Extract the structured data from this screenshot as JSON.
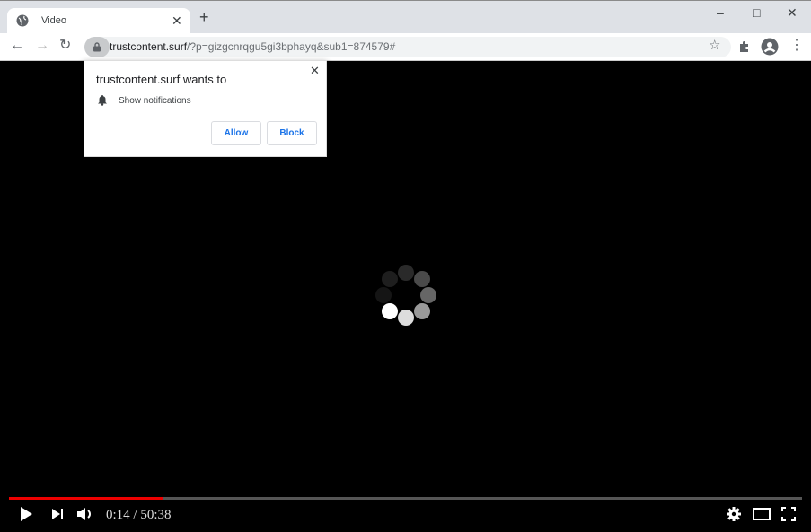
{
  "browser": {
    "tab": {
      "title": "Video",
      "icon": "globe-icon"
    },
    "new_tab": "+",
    "window_controls": {
      "minimize": "–",
      "maximize": "□",
      "close": "✕"
    },
    "nav": {
      "back": "←",
      "forward": "→",
      "reload": "↻"
    },
    "url": {
      "domain": "trustcontent.surf",
      "path": "/?p=gizgcnrqgu5gi3bphayq&sub1=874579#"
    },
    "toolbar_icons": {
      "bookmark": "☆",
      "extensions": "puzzle-icon",
      "profile": "account-icon",
      "menu": "⋮"
    }
  },
  "permission_popup": {
    "title": "trustcontent.surf wants to",
    "permission": "Show notifications",
    "allow_label": "Allow",
    "block_label": "Block",
    "close": "✕"
  },
  "player": {
    "current_time": "0:14",
    "duration": "50:38",
    "time_display": "0:14 / 50:38",
    "progress_fraction": 0.194,
    "accent_color": "#ee0000"
  }
}
